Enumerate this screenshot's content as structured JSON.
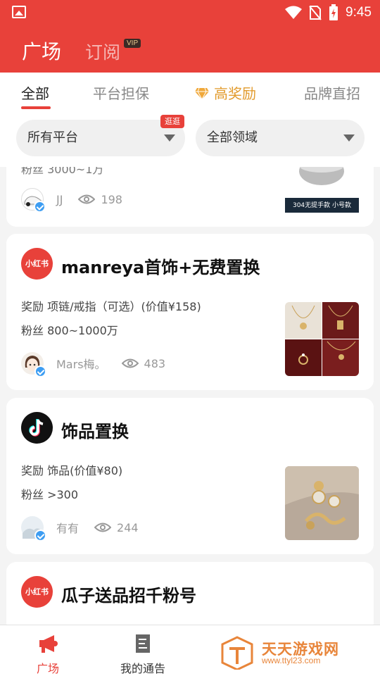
{
  "status_bar": {
    "time": "9:45"
  },
  "header": {
    "tabs": [
      {
        "label": "广场"
      },
      {
        "label": "订阅"
      }
    ],
    "vip_badge": "VIP"
  },
  "filter_tabs": [
    {
      "label": "全部",
      "active": true
    },
    {
      "label": "平台担保"
    },
    {
      "label": "高奖励",
      "icon": "diamond-icon"
    },
    {
      "label": "品牌直招"
    }
  ],
  "selects": {
    "platform": {
      "value": "所有平台",
      "badge": "逛逛"
    },
    "domain": {
      "value": "全部领域"
    }
  },
  "cards": [
    {
      "partial_text": "粉丝 3000~1万",
      "user": "JJ",
      "views": "198",
      "thumb_caption": "304无提手款  小号款"
    },
    {
      "platform": "小红书",
      "title": "manreya首饰+无费置换",
      "reward": "奖励 项链/戒指（可选）(价值¥158)",
      "fans": "粉丝 800~1000万",
      "user": "Mars梅。",
      "views": "483"
    },
    {
      "platform": "抖音",
      "title": "饰品置换",
      "reward": "奖励 饰品(价值¥80)",
      "fans": "粉丝 >300",
      "user": "有有",
      "views": "244"
    },
    {
      "platform": "小红书",
      "title": "瓜子送品招千粉号"
    }
  ],
  "bottom_nav": [
    {
      "label": "广场",
      "icon": "megaphone-icon",
      "active": true
    },
    {
      "label": "我的通告",
      "icon": "notice-icon"
    }
  ],
  "watermark": {
    "title": "天天游戏网",
    "url": "www.ttyl23.com"
  },
  "colors": {
    "brand_red": "#e8413a",
    "gold": "#e29b2d",
    "verify_blue": "#3d9df2"
  }
}
